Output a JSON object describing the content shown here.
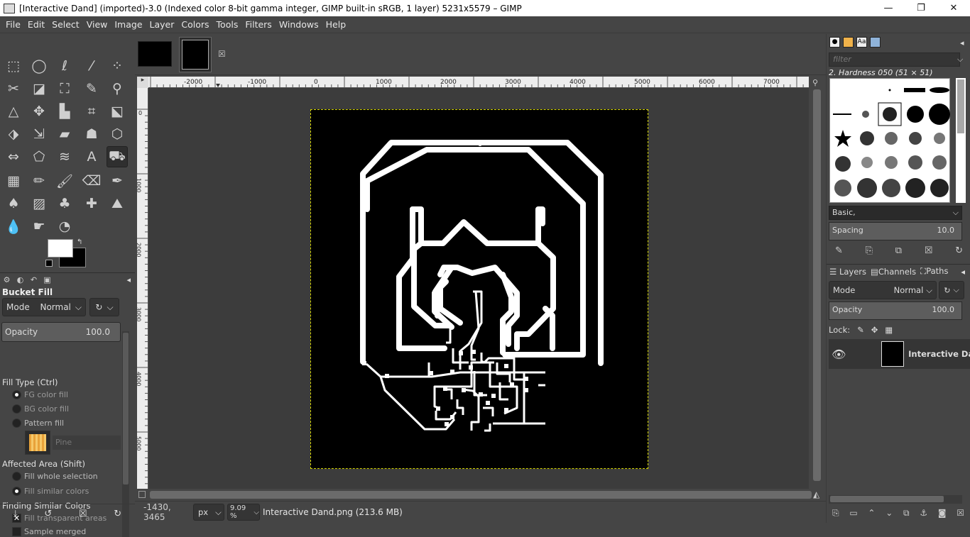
{
  "window": {
    "title": "[Interactive Dand] (imported)-3.0 (Indexed color 8-bit gamma integer, GIMP built-in sRGB, 1 layer) 5231x5579 – GIMP",
    "minimize": "—",
    "maximize": "❐",
    "close": "✕"
  },
  "menu": [
    "File",
    "Edit",
    "Select",
    "View",
    "Image",
    "Layer",
    "Colors",
    "Tools",
    "Filters",
    "Windows",
    "Help"
  ],
  "tool_options": {
    "heading": "Bucket Fill",
    "mode_label": "Mode",
    "mode_value": "Normal",
    "opacity_label": "Opacity",
    "opacity_value": "100.0",
    "fill_type_label": "Fill Type  (Ctrl)",
    "fill_fg": "FG color fill",
    "fill_bg": "BG color fill",
    "fill_pattern": "Pattern fill",
    "affected_label": "Affected Area  (Shift)",
    "fill_whole": "Fill whole selection",
    "fill_similar": "Fill similar colors",
    "finding_label": "Finding Similar Colors",
    "fill_transparent": "Fill transparent areas",
    "sample_merged": "Sample merged",
    "pattern_name": "Pine"
  },
  "ruler": {
    "h_labels": [
      "-2000",
      "-1000",
      "0",
      "1000",
      "2000",
      "3000",
      "4000",
      "5000",
      "6000",
      "7000"
    ],
    "v_labels": [
      "0",
      "1000",
      "2000",
      "3000",
      "4000",
      "5000"
    ]
  },
  "status": {
    "coords": "-1430, 3465",
    "unit": "px",
    "zoom": "9.09 %",
    "message": "Interactive Dand.png (213.6 MB)"
  },
  "brushes": {
    "filter_placeholder": "filter",
    "current": "2. Hardness 050 (51 × 51)",
    "tag": "Basic,",
    "spacing_label": "Spacing",
    "spacing_value": "10.0"
  },
  "layers": {
    "tab_layers": "Layers",
    "tab_channels": "Channels",
    "tab_paths": "Paths",
    "mode_label": "Mode",
    "mode_value": "Normal",
    "opacity_label": "Opacity",
    "opacity_value": "100.0",
    "lock_label": "Lock:",
    "layer_name": "Interactive Da"
  }
}
